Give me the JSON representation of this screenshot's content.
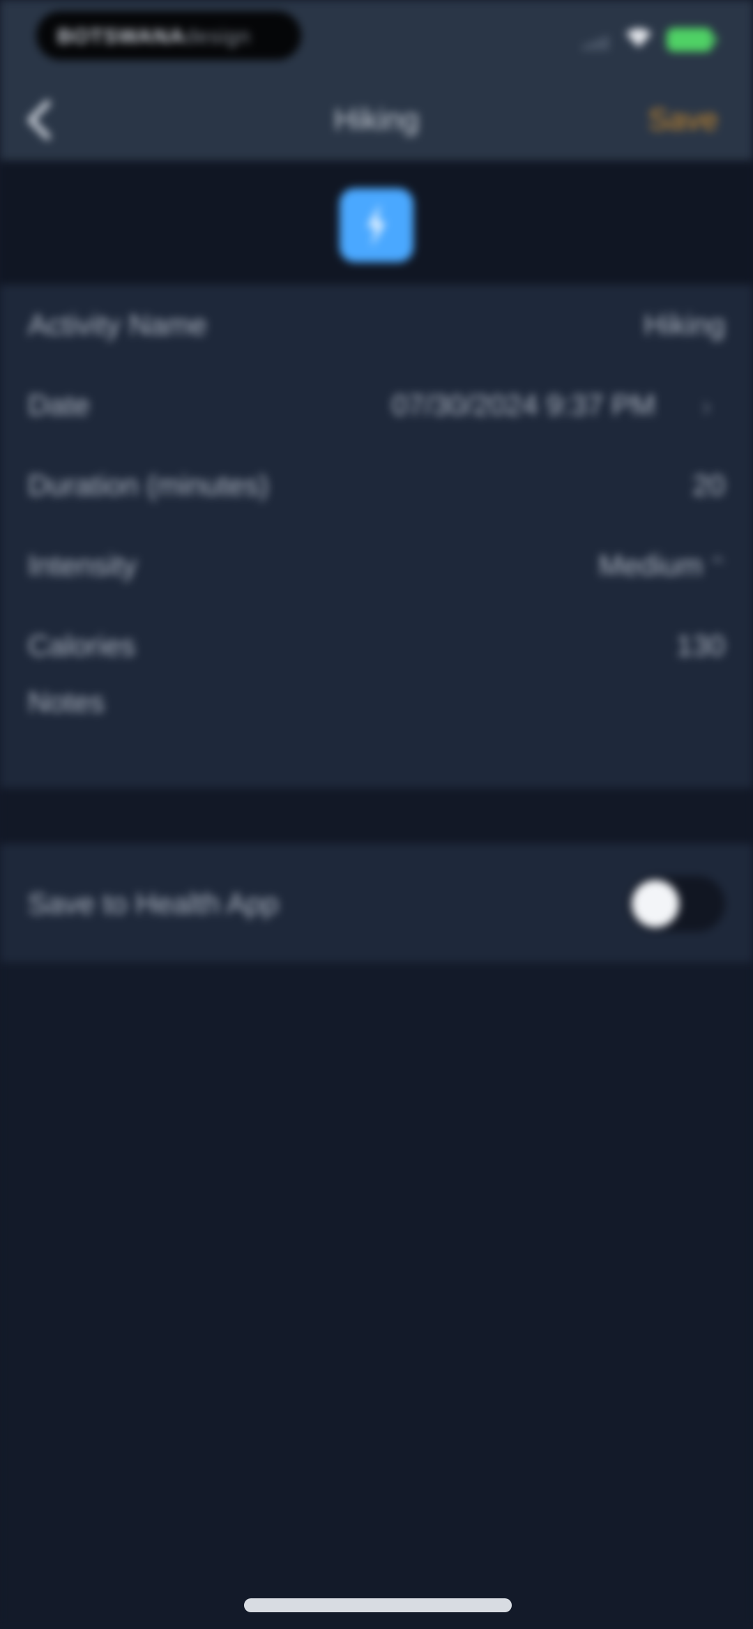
{
  "status_bar": {
    "island_text_bold": "BOTSWANA",
    "island_text_light": "design",
    "battery_color": "#4fd165"
  },
  "nav": {
    "back_icon": "chevron-left-icon",
    "title": "Hiking",
    "save_label": "Save",
    "save_color": "#c98a2e"
  },
  "header": {
    "activity_icon": "lightning-bolt-icon",
    "icon_color": "#4aa8ff"
  },
  "form": {
    "activity_name": {
      "label": "Activity Name",
      "value": "Hiking"
    },
    "date": {
      "label": "Date",
      "value": "07/30/2024 9:37 PM"
    },
    "duration": {
      "label": "Duration (minutes)",
      "value": "20"
    },
    "intensity": {
      "label": "Intensity",
      "value": "Medium"
    },
    "calories": {
      "label": "Calories",
      "value": "130"
    },
    "notes": {
      "label": "Notes",
      "value": ""
    }
  },
  "health": {
    "label": "Save to Health App",
    "toggle_on": false
  }
}
